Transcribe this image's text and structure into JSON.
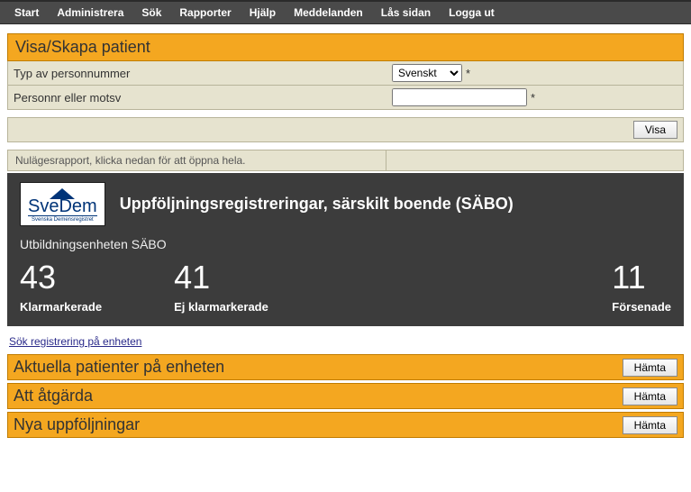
{
  "menu": [
    "Start",
    "Administrera",
    "Sök",
    "Rapporter",
    "Hjälp",
    "Meddelanden",
    "Lås sidan",
    "Logga ut"
  ],
  "patient": {
    "header": "Visa/Skapa patient",
    "type_label": "Typ av personnummer",
    "type_selected": "Svenskt",
    "personnr_label": "Personnr eller motsv",
    "personnr_value": "",
    "asterisk": "*",
    "visa_btn": "Visa"
  },
  "report_hint": "Nulägesrapport, klicka nedan för att öppna hela.",
  "logo": {
    "main": "SveDem",
    "sub": "Svenska Demensregistret"
  },
  "panel": {
    "title": "Uppföljningsregistreringar, särskilt boende (SÄBO)",
    "unit": "Utbildningsenheten SÄBO"
  },
  "stats": {
    "klar": {
      "val": "43",
      "lbl": "Klarmarkerade"
    },
    "ej": {
      "val": "41",
      "lbl": "Ej klarmarkerade"
    },
    "fors": {
      "val": "11",
      "lbl": "Försenade"
    }
  },
  "search_link": "Sök registrering på enheten",
  "actions": {
    "aktuella": "Aktuella patienter på enheten",
    "atgarda": "Att åtgärda",
    "nyupp": "Nya uppföljningar",
    "hamta": "Hämta"
  }
}
